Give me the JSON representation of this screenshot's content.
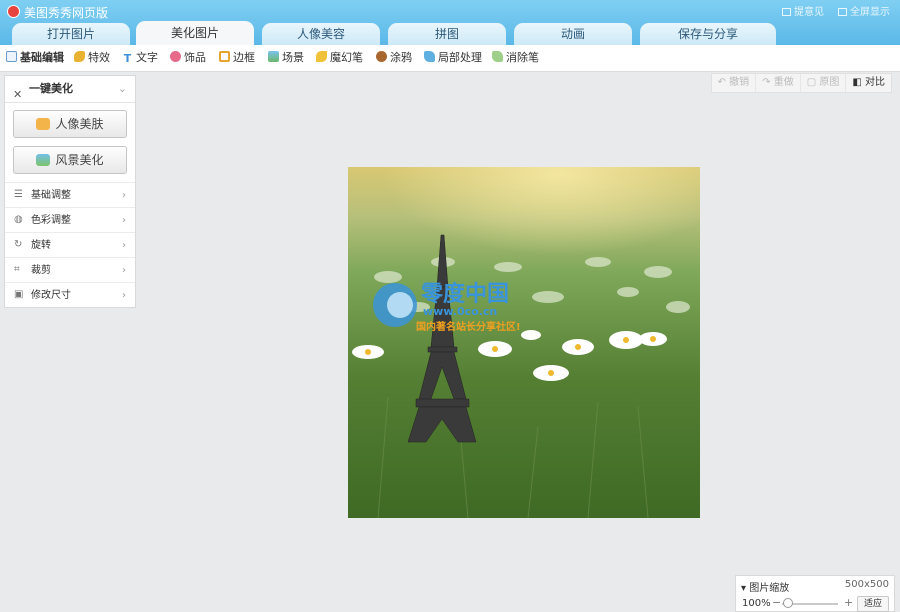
{
  "app": {
    "title": "美图秀秀网页版",
    "top_links": [
      "提意见",
      "全屏显示"
    ]
  },
  "tabs": [
    "打开图片",
    "美化图片",
    "人像美容",
    "拼图",
    "动画",
    "保存与分享"
  ],
  "active_tab": "美化图片",
  "toolbar": {
    "items": [
      {
        "label": "基础编辑",
        "icon": "edit-icon"
      },
      {
        "label": "特效",
        "icon": "magic-wand-icon"
      },
      {
        "label": "文字",
        "icon": "text-icon"
      },
      {
        "label": "饰品",
        "icon": "bow-icon"
      },
      {
        "label": "边框",
        "icon": "frame-icon"
      },
      {
        "label": "场景",
        "icon": "scene-icon"
      },
      {
        "label": "魔幻笔",
        "icon": "magic-pen-icon"
      },
      {
        "label": "涂鸦",
        "icon": "brush-icon"
      },
      {
        "label": "局部处理",
        "icon": "local-edit-icon"
      },
      {
        "label": "消除笔",
        "icon": "eraser-icon"
      }
    ]
  },
  "left_panel": {
    "header": "一键美化",
    "buttons": [
      {
        "label": "人像美肤",
        "icon": "portrait-icon"
      },
      {
        "label": "风景美化",
        "icon": "landscape-icon"
      }
    ],
    "menu": [
      {
        "label": "基础调整",
        "icon": "adjust-icon"
      },
      {
        "label": "色彩调整",
        "icon": "palette-icon"
      },
      {
        "label": "旋转",
        "icon": "rotate-icon"
      },
      {
        "label": "裁剪",
        "icon": "crop-icon"
      },
      {
        "label": "修改尺寸",
        "icon": "resize-icon"
      }
    ]
  },
  "right_tools": [
    {
      "label": "撤销",
      "icon": "undo-icon",
      "enabled": false
    },
    {
      "label": "重做",
      "icon": "redo-icon",
      "enabled": false
    },
    {
      "label": "原图",
      "icon": "original-icon",
      "enabled": false
    },
    {
      "label": "对比",
      "icon": "compare-icon",
      "enabled": true
    }
  ],
  "watermark": {
    "brand": "零度中国",
    "url": "www.0co.cn",
    "tagline": "国内著名站长分享社区!"
  },
  "zoom": {
    "title": "图片缩放",
    "size": "500x500",
    "percent": "100%",
    "fit_label": "适应",
    "level": 0.1
  }
}
